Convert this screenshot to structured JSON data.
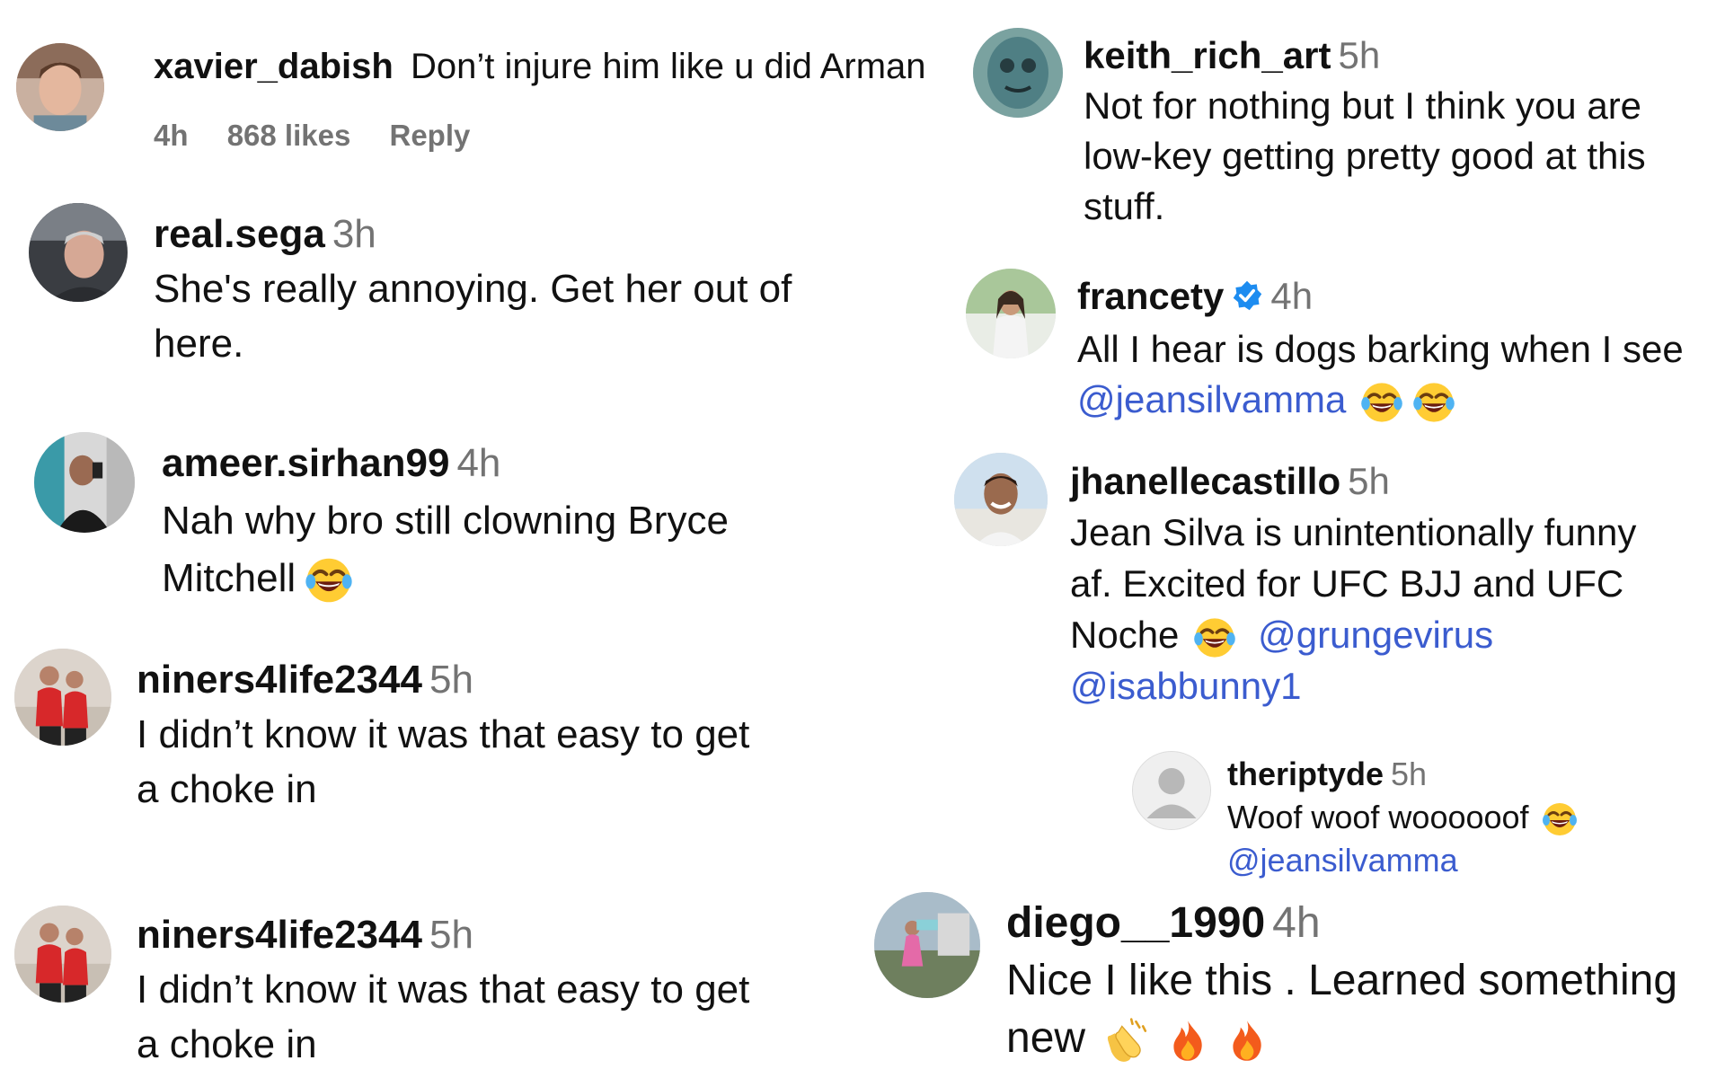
{
  "comments": [
    {
      "username": "xavier_dabish",
      "text": "Don’t injure him like u did Arman",
      "time": "4h",
      "likes": "868 likes",
      "reply": "Reply",
      "avatar": "young-man-selfie"
    },
    {
      "username": "real.sega",
      "time": "3h",
      "line1": "She's really annoying. Get her out of",
      "line2": "here.",
      "avatar": "man-in-car"
    },
    {
      "username": "ameer.sirhan99",
      "time": "4h",
      "line1": "Nah why bro still clowning Bryce",
      "line2": "Mitchell",
      "emoji": "laughing-tears",
      "avatar": "mirror-selfie"
    },
    {
      "username": "niners4life2344",
      "time": "5h",
      "line1": "I didn’t know it was that easy to get",
      "line2": "a choke in",
      "avatar": "couple-red-shirts"
    },
    {
      "username": "niners4life2344",
      "time": "5h",
      "line1": "I didn’t know it was that easy to get",
      "line2": "a choke in",
      "avatar": "couple-red-shirts"
    },
    {
      "username": "keith_rich_art",
      "time": "5h",
      "line1": "Not for nothing but I think you are",
      "line2": "low-key getting pretty good at this",
      "line3": "stuff.",
      "avatar": "painted-figure"
    },
    {
      "username": "francety",
      "time": "4h",
      "verified": true,
      "line1": "All I hear is dogs barking when I see",
      "mention": "@jeansilvamma",
      "emoji": "laughing-tears",
      "avatar": "woman-white-outfit"
    },
    {
      "username": "jhanellecastillo",
      "time": "5h",
      "line1": "Jean Silva is unintentionally funny",
      "line2": "af. Excited for UFC BJJ and UFC",
      "line3": "Noche",
      "mention1": "@grungevirus",
      "mention2": "@isabbunny1",
      "emoji": "laughing-tears",
      "avatar": "smiling-man-outdoors"
    },
    {
      "username": "theriptyde",
      "time": "5h",
      "line1": "Woof woof woooooof",
      "mention": "@jeansilvamma",
      "emoji": "laughing-tears",
      "avatar": "default-person"
    },
    {
      "username": "diego__1990",
      "time": "4h",
      "line1": "Nice I like this . Learned something",
      "line2": "new",
      "emojis": [
        "clapping-hands",
        "fire",
        "fire"
      ],
      "avatar": "outdoor-scene"
    }
  ],
  "colors": {
    "username": "#111111",
    "text": "#111111",
    "muted": "#737373",
    "mention": "#3b5ccf",
    "verified": "#1d8cf0"
  }
}
